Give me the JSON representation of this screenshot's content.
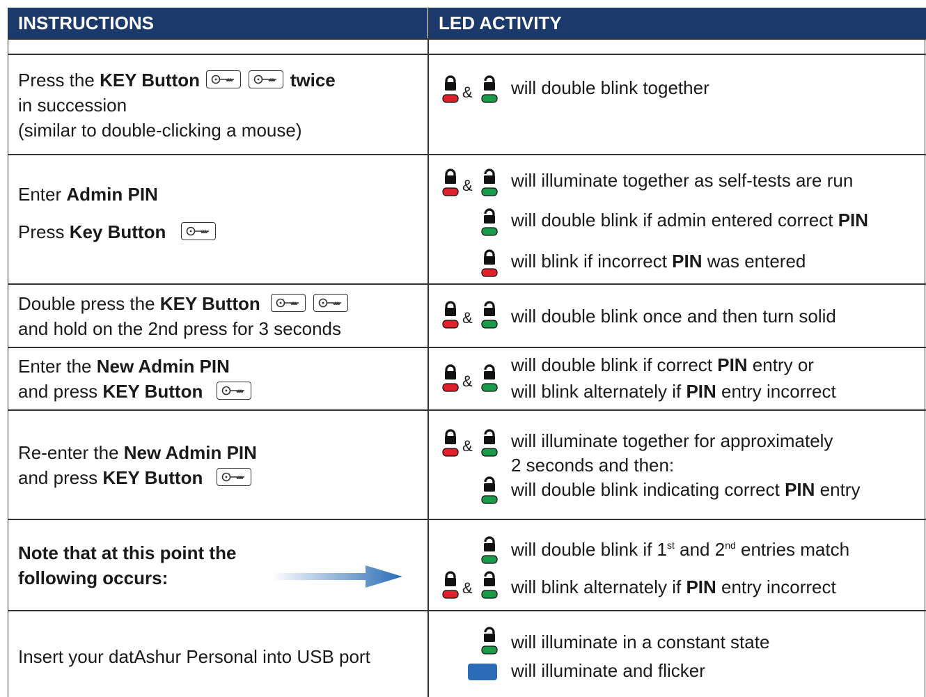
{
  "header": {
    "instructions": "INSTRUCTIONS",
    "led_activity": "LED ACTIVITY"
  },
  "amp": "&",
  "rows": [
    {
      "left": [
        "Press the ",
        "KEY Button",
        "twice",
        "in succession",
        "(similar to double-clicking a mouse)"
      ],
      "right": [
        "will double blink together"
      ]
    },
    {
      "left": [
        "Enter ",
        "Admin PIN",
        "Press ",
        "Key Button"
      ],
      "right": [
        "will illuminate together as self-tests are run",
        "will double blink if admin entered correct ",
        "PIN",
        "will blink if incorrect ",
        "PIN",
        " was entered"
      ]
    },
    {
      "left": [
        "Double press the ",
        "KEY Button",
        "and hold on the 2nd press for 3 seconds"
      ],
      "right": [
        "will double blink once and then turn solid"
      ]
    },
    {
      "left": [
        "Enter the ",
        "New Admin PIN",
        "and press ",
        "KEY Button"
      ],
      "right": [
        "will double blink if correct ",
        "PIN",
        " entry or",
        "will blink alternately if ",
        "PIN",
        " entry incorrect"
      ]
    },
    {
      "left": [
        "Re-enter the ",
        "New Admin PIN",
        "and press ",
        "KEY Button"
      ],
      "right": [
        "will illuminate together for approximately",
        "2 seconds and then:",
        "will double blink indicating correct ",
        "PIN",
        " entry"
      ]
    },
    {
      "left": [
        "Note that at this point the",
        "following occurs:"
      ],
      "right": [
        "will double blink if 1",
        "st",
        " and 2",
        "nd",
        " entries match",
        "will blink alternately if ",
        "PIN",
        " entry incorrect"
      ]
    },
    {
      "left": [
        "Insert your datAshur Personal into USB port"
      ],
      "right": [
        "will illuminate in a constant state",
        "will illuminate and flicker"
      ]
    }
  ],
  "colors": {
    "header_bg": "#1b3a6b",
    "led_red": "#e0202a",
    "led_green": "#1a9a4a",
    "led_blue": "#2a6cb6"
  }
}
